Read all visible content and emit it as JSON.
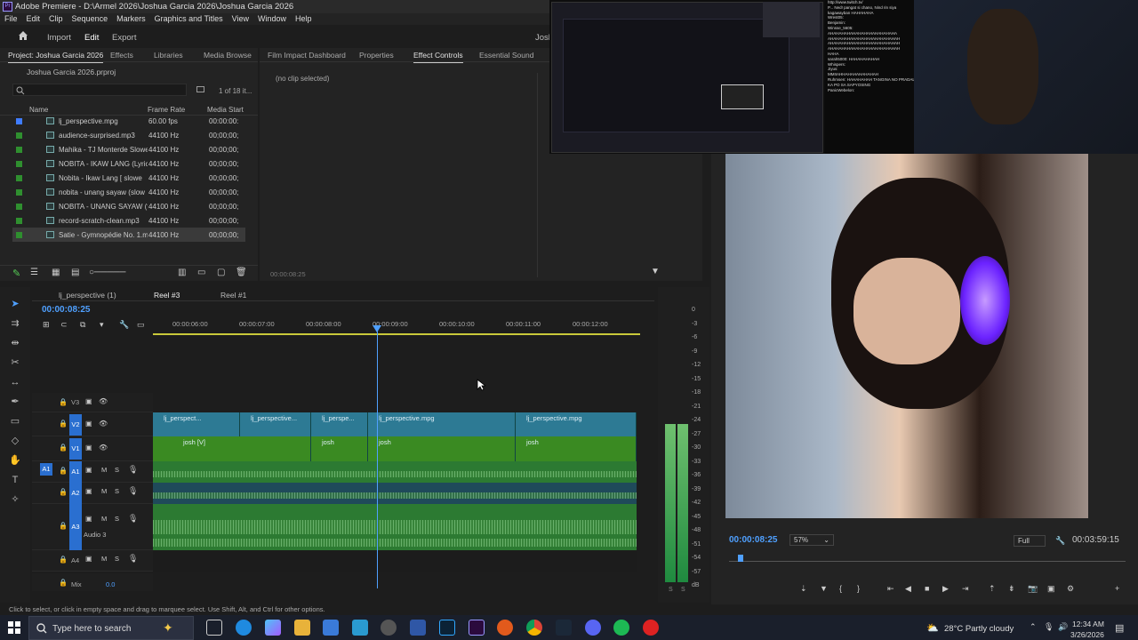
{
  "window": {
    "title": "Adobe Premiere - D:\\Armel 2026\\Joshua Garcia 2026\\Joshua Garcia 2026",
    "app_icon": "Pr"
  },
  "menu": [
    "File",
    "Edit",
    "Clip",
    "Sequence",
    "Markers",
    "Graphics and Titles",
    "View",
    "Window",
    "Help"
  ],
  "workspace": {
    "tabs": [
      "Import",
      "Edit",
      "Export"
    ],
    "active": "Edit",
    "user": "Josh"
  },
  "project_panel": {
    "tabs": [
      "Project: Joshua Garcia 2026",
      "Effects",
      "Libraries",
      "Media Browse"
    ],
    "path": "Joshua Garcia 2026.prproj",
    "search_placeholder": "",
    "count": "1 of 18 it...",
    "columns": [
      "Name",
      "Frame Rate",
      "Media Start"
    ],
    "items": [
      {
        "name": "lj_perspective.mpg",
        "rate": "60.00 fps",
        "start": "00:00:00:"
      },
      {
        "name": "audience-surprised.mp3",
        "rate": "44100 Hz",
        "start": "00;00;00;"
      },
      {
        "name": "Mahika - TJ Monterde  Slowe",
        "rate": "44100 Hz",
        "start": "00;00;00;"
      },
      {
        "name": "NOBITA - IKAW LANG (Lyrics",
        "rate": "44100 Hz",
        "start": "00;00;00;"
      },
      {
        "name": "Nobita - Ikaw Lang [ slowe",
        "rate": "44100 Hz",
        "start": "00;00;00;"
      },
      {
        "name": "nobita - unang sayaw (slow",
        "rate": "44100 Hz",
        "start": "00;00;00;"
      },
      {
        "name": "NOBITA - UNANG SAYAW (f",
        "rate": "44100 Hz",
        "start": "00;00;00;"
      },
      {
        "name": "record-scratch-clean.mp3",
        "rate": "44100 Hz",
        "start": "00;00;00;"
      },
      {
        "name": "Satie - Gymnopédie No. 1.m",
        "rate": "44100 Hz",
        "start": "00;00;00;"
      }
    ]
  },
  "effect_panel": {
    "tabs": [
      "Film Impact Dashboard",
      "Properties",
      "Effect Controls",
      "Essential Sound"
    ],
    "active": "Effect Controls",
    "message": "(no clip selected)",
    "timecode": "00:00:08:25"
  },
  "timeline": {
    "tabs": [
      "lj_perspective (1)",
      "Reel #3",
      "Reel #1"
    ],
    "active_tab": "Reel #3",
    "timecode": "00:00:08:25",
    "ruler": [
      "00:00:06:00",
      "00:00:07:00",
      "00:00:08:00",
      "00:00:09:00",
      "00:00:10:00",
      "00:00:11:00",
      "00:00:12:00"
    ],
    "tracks": {
      "v3": "V3",
      "v2": "V2",
      "v1": "V1",
      "a1": "A1",
      "a2": "A2",
      "a3": "A3",
      "a3_name": "Audio 3",
      "a4": "A4",
      "mix": "Mix",
      "mix_val": "0.0",
      "src_v1": "V1",
      "src_a1": "A1"
    },
    "v2_clips": [
      "lj_perspect...",
      "lj_perspective...",
      "lj_perspe...",
      "lj_perspective.mpg",
      "lj_perspective.mpg"
    ],
    "v1_clips": [
      "josh [V]",
      "josh",
      "josh",
      "josh"
    ],
    "meter_scale": [
      "0",
      "-3",
      "-6",
      "-9",
      "-12",
      "-15",
      "-18",
      "-21",
      "-24",
      "-27",
      "-30",
      "-33",
      "-36",
      "-39",
      "-42",
      "-45",
      "-48",
      "-51",
      "-54",
      "-57",
      "dB"
    ],
    "meter_labels": [
      "S",
      "S"
    ]
  },
  "program_monitor": {
    "timecode": "00:00:08:25",
    "zoom": "57%",
    "quality": "Full",
    "duration": "00:03:59:15"
  },
  "status_bar": "Click to select, or click in empty space and drag to marquee select. Use Shift, Alt, and Ctrl for other options.",
  "chat_lines": [
    "http://www.twitch.tv/",
    "P... Ned! pangat si chano, Nind rin siya",
    "kagawayban HAHAHAHA",
    "Wrest05:",
    "Benjamin:",
    "Winsse_5605:",
    "AHAHAHAHAHAHAHAHAHAHAHAHA",
    "AHAHAHAHAHAHAHAHAHAHAHAHAH",
    "AHAHAHAHAHAHAHAHAHAHAHAHAH",
    "AHAHAHAHAHAHAHAHAHAHAHAHAH",
    "HAHA",
    "sarah5000: HAHAHAHAHAH",
    "Whispers:",
    "Jiyus:",
    "MMIIAHHAHAHAHAHAHAH",
    "Ruhmsen: HAHAHAHAH TANGINA NO PRADALA",
    "KA PO SA SAPYOSING",
    "PanicWebelon:"
  ],
  "taskbar": {
    "search_placeholder": "Type here to search",
    "weather": "28°C  Partly cloudy",
    "time": "12:34 AM",
    "date": "3/26/2026"
  }
}
